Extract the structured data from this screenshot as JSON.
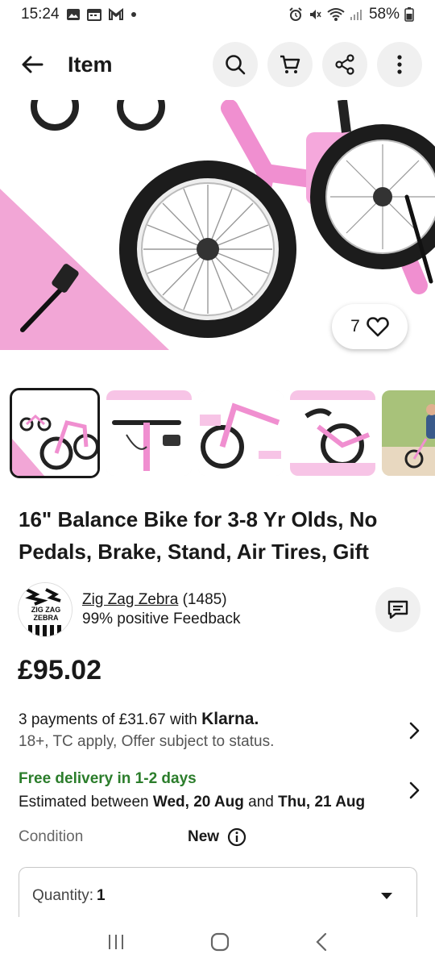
{
  "status_bar": {
    "time": "15:24",
    "battery": "58%"
  },
  "header": {
    "title": "Item"
  },
  "hero": {
    "watch_count": "7"
  },
  "item": {
    "title": "16\" Balance Bike for 3-8 Yr Olds, No Pedals, Brake, Stand, Air Tires, Gift"
  },
  "seller": {
    "logo_line1": "ZIG ZAG",
    "logo_line2": "ZEBRA",
    "name": "Zig Zag Zebra",
    "count": "(1485)",
    "feedback": "99% positive Feedback"
  },
  "price": "£95.02",
  "klarna": {
    "line_prefix": "3 payments of £31.67 with ",
    "logo": "Klarna.",
    "sub": "18+, TC apply, Offer subject to status."
  },
  "delivery": {
    "free": "Free delivery in 1-2 days",
    "est_prefix": "Estimated between ",
    "date_from": "Wed, 20 Aug",
    "and": " and ",
    "date_to": "Thu, 21 Aug"
  },
  "condition": {
    "label": "Condition",
    "value": "New"
  },
  "quantity": {
    "label": "Quantity:",
    "value": "1"
  },
  "colors": {
    "accent_green": "#2b7d2b",
    "pink": "#f2a6d6",
    "text": "#191919"
  }
}
